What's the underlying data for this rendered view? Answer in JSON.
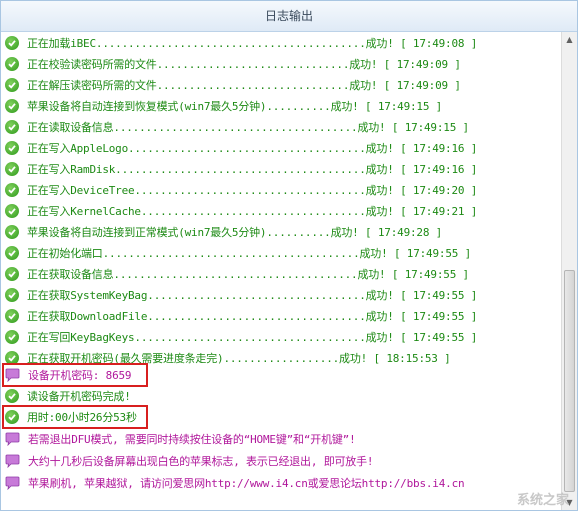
{
  "window": {
    "title": "日志输出"
  },
  "log": [
    {
      "icon": "ok",
      "text": "正在加载iBEC..........................................成功! [ 17:49:08 ]"
    },
    {
      "icon": "ok",
      "text": "正在校验读密码所需的文件..............................成功! [ 17:49:09 ]"
    },
    {
      "icon": "ok",
      "text": "正在解压读密码所需的文件..............................成功! [ 17:49:09 ]"
    },
    {
      "icon": "ok",
      "text": "苹果设备将自动连接到恢复模式(win7最久5分钟)..........成功! [ 17:49:15 ]"
    },
    {
      "icon": "ok",
      "text": "正在读取设备信息......................................成功! [ 17:49:15 ]"
    },
    {
      "icon": "ok",
      "text": "正在写入AppleLogo.....................................成功! [ 17:49:16 ]"
    },
    {
      "icon": "ok",
      "text": "正在写入RamDisk.......................................成功! [ 17:49:16 ]"
    },
    {
      "icon": "ok",
      "text": "正在写入DeviceTree....................................成功! [ 17:49:20 ]"
    },
    {
      "icon": "ok",
      "text": "正在写入KernelCache...................................成功! [ 17:49:21 ]"
    },
    {
      "icon": "ok",
      "text": "苹果设备将自动连接到正常模式(win7最久5分钟)..........成功! [ 17:49:28 ]"
    },
    {
      "icon": "ok",
      "text": "正在初始化端口........................................成功! [ 17:49:55 ]"
    },
    {
      "icon": "ok",
      "text": "正在获取设备信息......................................成功! [ 17:49:55 ]"
    },
    {
      "icon": "ok",
      "text": "正在获取SystemKeyBag..................................成功! [ 17:49:55 ]"
    },
    {
      "icon": "ok",
      "text": "正在获取DownloadFile..................................成功! [ 17:49:55 ]"
    },
    {
      "icon": "ok",
      "text": "正在写回KeyBagKeys....................................成功! [ 17:49:55 ]"
    },
    {
      "icon": "ok",
      "text": "正在获取开机密码(最久需要进度条走完)..................成功! [ 18:15:53 ]"
    },
    {
      "icon": "msg",
      "text": "设备开机密码: 8659"
    },
    {
      "icon": "ok",
      "text": "读设备开机密码完成!"
    },
    {
      "icon": "ok",
      "text": "用时:00小时26分53秒"
    },
    {
      "icon": "msg",
      "text": "若需退出DFU模式, 需要同时持续按住设备的“HOME键”和“开机键”!"
    },
    {
      "icon": "msg",
      "text": "大约十几秒后设备屏幕出现白色的苹果标志, 表示已经退出, 即可放手!"
    },
    {
      "icon": "msg",
      "text": "苹果刷机, 苹果越狱, 请访问爱思网http://www.i4.cn或爱思论坛http://bbs.i4.cn"
    }
  ],
  "watermark": "系统之家",
  "colors": {
    "success": "#1d8a14",
    "notice": "#b0179b",
    "highlight_border": "#d81f1f"
  }
}
